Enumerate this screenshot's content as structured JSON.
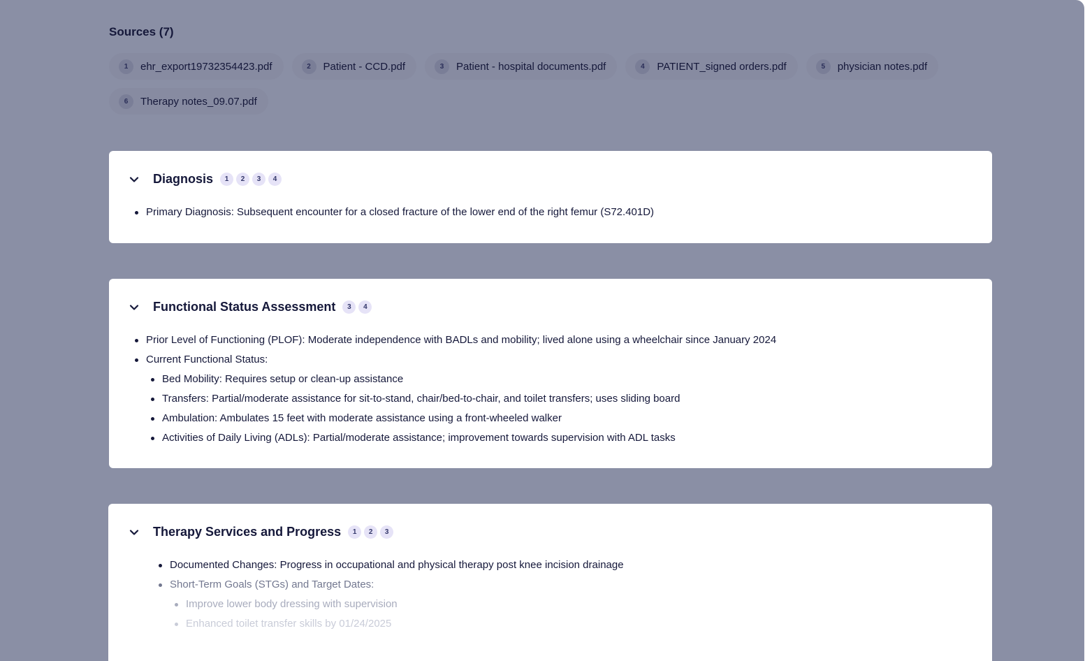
{
  "sources": {
    "title": "Sources (7)",
    "items": [
      {
        "num": "1",
        "name": "ehr_export19732354423.pdf"
      },
      {
        "num": "2",
        "name": "Patient - CCD.pdf"
      },
      {
        "num": "3",
        "name": "Patient - hospital documents.pdf"
      },
      {
        "num": "4",
        "name": "PATIENT_signed orders.pdf"
      },
      {
        "num": "5",
        "name": "physician notes.pdf"
      },
      {
        "num": "6",
        "name": "Therapy notes_09.07.pdf"
      }
    ]
  },
  "diagnosis": {
    "title": "Diagnosis",
    "citations": [
      "1",
      "2",
      "3",
      "4"
    ],
    "items": [
      "Primary Diagnosis: Subsequent encounter for a closed fracture of the lower end of the right femur (S72.401D)"
    ]
  },
  "functional": {
    "title": "Functional Status Assessment",
    "citations": [
      "3",
      "4"
    ],
    "plof": "Prior Level of Functioning (PLOF): Moderate independence with BADLs and mobility; lived alone using a wheelchair since January 2024",
    "current": "Current Functional Status:",
    "subitems": [
      "Bed Mobility: Requires setup or clean-up assistance",
      "Transfers: Partial/moderate assistance for sit-to-stand, chair/bed-to-chair, and toilet transfers; uses sliding board",
      "Ambulation: Ambulates 15 feet with moderate assistance using a front-wheeled walker",
      "Activities of Daily Living (ADLs): Partial/moderate assistance; improvement towards supervision with ADL tasks"
    ]
  },
  "therapy": {
    "title": "Therapy Services and Progress",
    "citations": [
      "1",
      "2",
      "3"
    ],
    "changes": "Documented Changes: Progress in occupational and physical therapy post knee incision drainage",
    "stg": "Short-Term Goals (STGs) and Target Dates:",
    "stg_items": [
      "Improve lower body dressing with supervision",
      "Enhanced toilet transfer skills by 01/24/2025"
    ]
  },
  "icons": {
    "chevron": "chevron-down-icon"
  },
  "colors": {
    "overlay": "#8a8fa5",
    "card": "#ffffff",
    "text": "#15183a",
    "citation_bg": "#e6e3f7"
  }
}
